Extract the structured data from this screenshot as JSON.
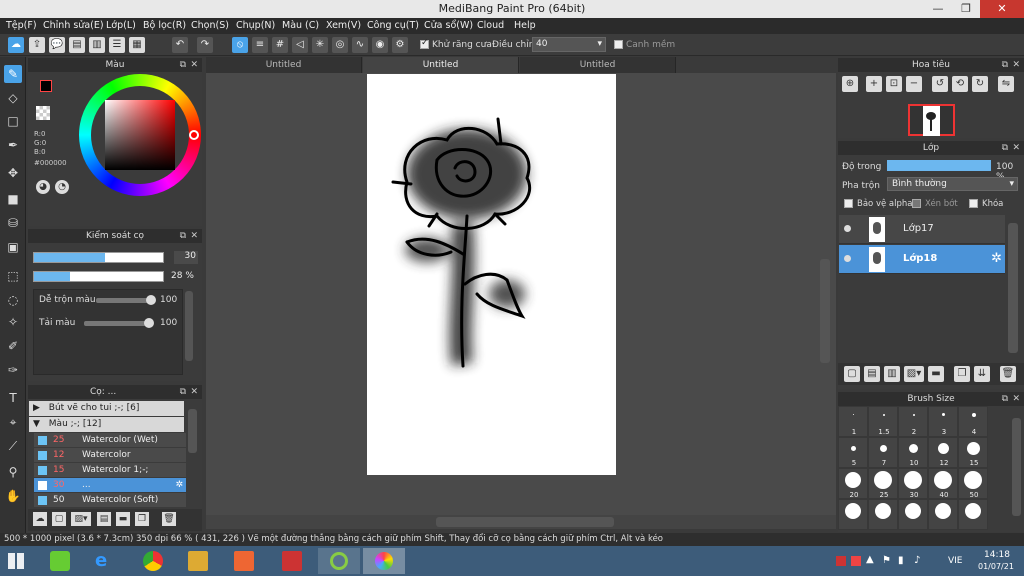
{
  "window": {
    "title": "MediBang Paint Pro (64bit)",
    "min": "—",
    "max": "❐",
    "close": "✕"
  },
  "menu": [
    "Tệp(F)",
    "Chỉnh sửa(E)",
    "Lớp(L)",
    "Bộ lọc(R)",
    "Chọn(S)",
    "Chụp(N)",
    "Màu (C)",
    "Xem(V)",
    "Công cụ(T)",
    "Cửa sổ(W)",
    "Cloud",
    "Help"
  ],
  "toolbar": {
    "antialias_label": "Khử răng cưa",
    "correction_label": "Điều chỉnh",
    "correction_value": "40",
    "snap_label": "Canh mềm"
  },
  "tabs": [
    "Untitled",
    "Untitled",
    "Untitled"
  ],
  "color_panel": {
    "title": "Màu",
    "r": "R:0",
    "g": "G:0",
    "b": "B:0",
    "hex": "#000000",
    "primary": "#000000",
    "secondary": "#8fb4e6"
  },
  "brush_control": {
    "title": "Kiểm soát cọ",
    "size_value": "30",
    "size_fill": 0.55,
    "opacity_value": "28 %",
    "opacity_fill": 0.28,
    "blend_label": "Dễ trộn màu",
    "blend_value": "100",
    "blend_fill": 1.0,
    "load_label": "Tải màu",
    "load_value": "100",
    "load_fill": 1.0
  },
  "brush_list": {
    "title": "Cọ: ...",
    "groups": [
      {
        "label": "Bút vẽ cho tui ;-; [6]",
        "arrow": "▶"
      },
      {
        "label": "Màu ;-; [12]",
        "arrow": "▼"
      }
    ],
    "items": [
      {
        "num": "25",
        "label": "Watercolor (Wet)"
      },
      {
        "num": "12",
        "label": "Watercolor"
      },
      {
        "num": "15",
        "label": "Watercolor 1;-;"
      },
      {
        "num": "30",
        "label": "..."
      },
      {
        "num": "50",
        "label": "Watercolor (Soft)"
      }
    ]
  },
  "navigator": {
    "title": "Hoa tiêu"
  },
  "layer_panel": {
    "title": "Lớp",
    "opacity_label": "Độ trong",
    "opacity_value": "100 %",
    "opacity_fill": 1.0,
    "blend_label": "Pha trộn",
    "blend_value": "Bình thường",
    "protect_alpha": "Bảo vệ alpha",
    "clipping": "Xén bớt",
    "lock": "Khóa",
    "layers": [
      {
        "name": "Lớp17",
        "selected": false
      },
      {
        "name": "Lớp18",
        "selected": true
      }
    ]
  },
  "brush_size": {
    "title": "Brush Size",
    "sizes": [
      "1",
      "1.5",
      "2",
      "3",
      "4",
      "5",
      "7",
      "10",
      "12",
      "15",
      "20",
      "25",
      "30",
      "40",
      "50"
    ]
  },
  "status": {
    "text": "500 * 1000 pixel   (3.6 * 7.3cm)   350 dpi   66 %   ( 431, 226 )   Vẽ một đường thẳng bằng cách giữ phím Shift, Thay đổi cỡ cọ bằng cách giữ phím Ctrl, Alt và kéo"
  },
  "taskbar": {
    "lang": "VIE",
    "time": "14:18",
    "date": "01/07/21"
  }
}
